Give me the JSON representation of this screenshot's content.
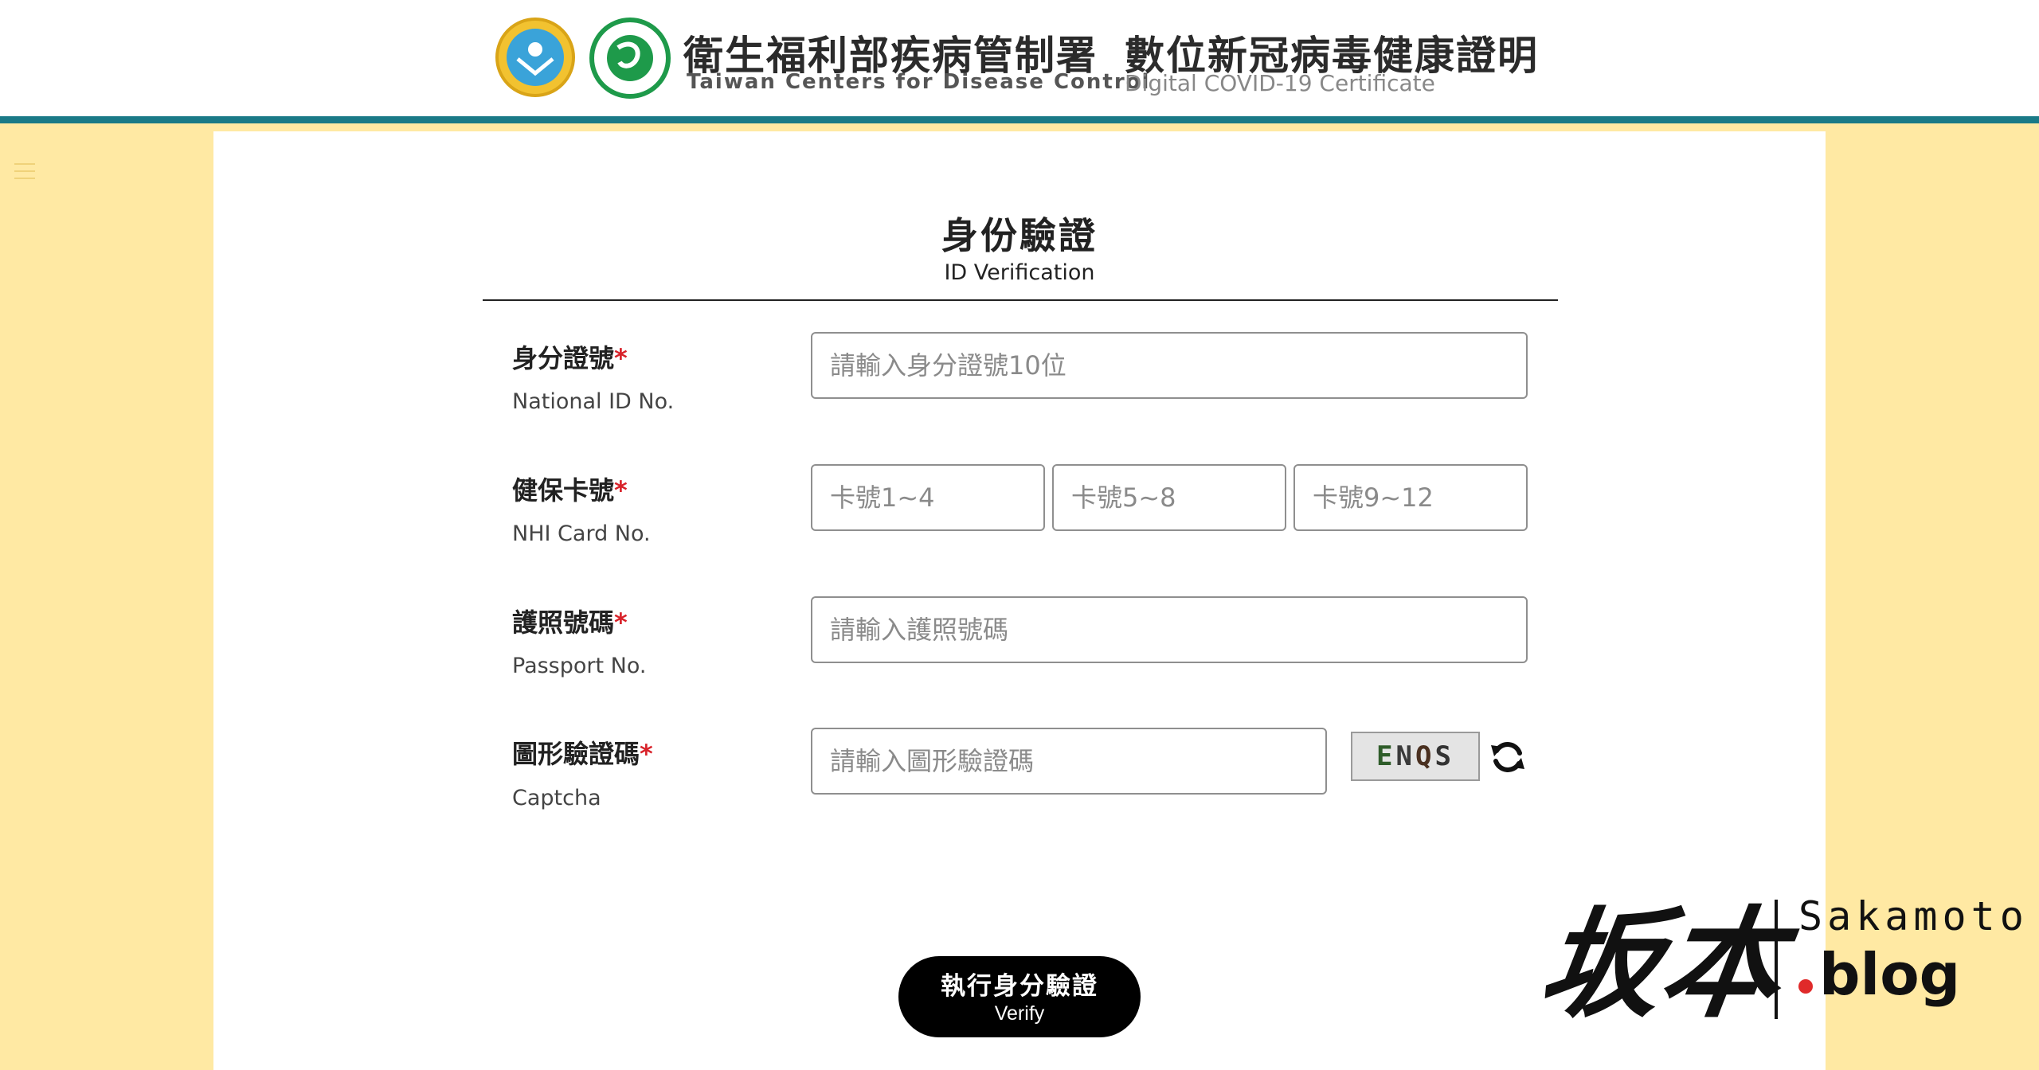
{
  "header": {
    "agency_zh": "衛生福利部疾病管制署",
    "agency_en": "Taiwan Centers for Disease Control",
    "service_zh": "數位新冠病毒健康證明",
    "service_en": "Digital COVID-19 Certificate"
  },
  "form": {
    "title_zh": "身份驗證",
    "title_en": "ID Verification",
    "required_mark": "*",
    "national_id": {
      "label_zh": "身分證號",
      "label_en": "National ID No.",
      "placeholder": "請輸入身分證號10位",
      "value": ""
    },
    "nhi_card": {
      "label_zh": "健保卡號",
      "label_en": "NHI Card No.",
      "placeholders": [
        "卡號1~4",
        "卡號5~8",
        "卡號9~12"
      ]
    },
    "passport": {
      "label_zh": "護照號碼",
      "label_en": "Passport No.",
      "placeholder": "請輸入護照號碼",
      "value": ""
    },
    "captcha": {
      "label_zh": "圖形驗證碼",
      "label_en": "Captcha",
      "placeholder": "請輸入圖形驗證碼",
      "code": [
        "E",
        "N",
        "Q",
        "S"
      ]
    },
    "submit": {
      "label_zh": "執行身分驗證",
      "label_en": "Verify"
    }
  },
  "watermark": {
    "kanji": "坂本",
    "latin": "Sakamoto",
    "suffix": "blog"
  },
  "icons": {
    "menu": "hamburger-icon",
    "refresh": "refresh-icon"
  },
  "colors": {
    "header_rule": "#1a7a87",
    "page_side": "#ffe9a3",
    "required": "#d8222a",
    "button": "#000000"
  }
}
